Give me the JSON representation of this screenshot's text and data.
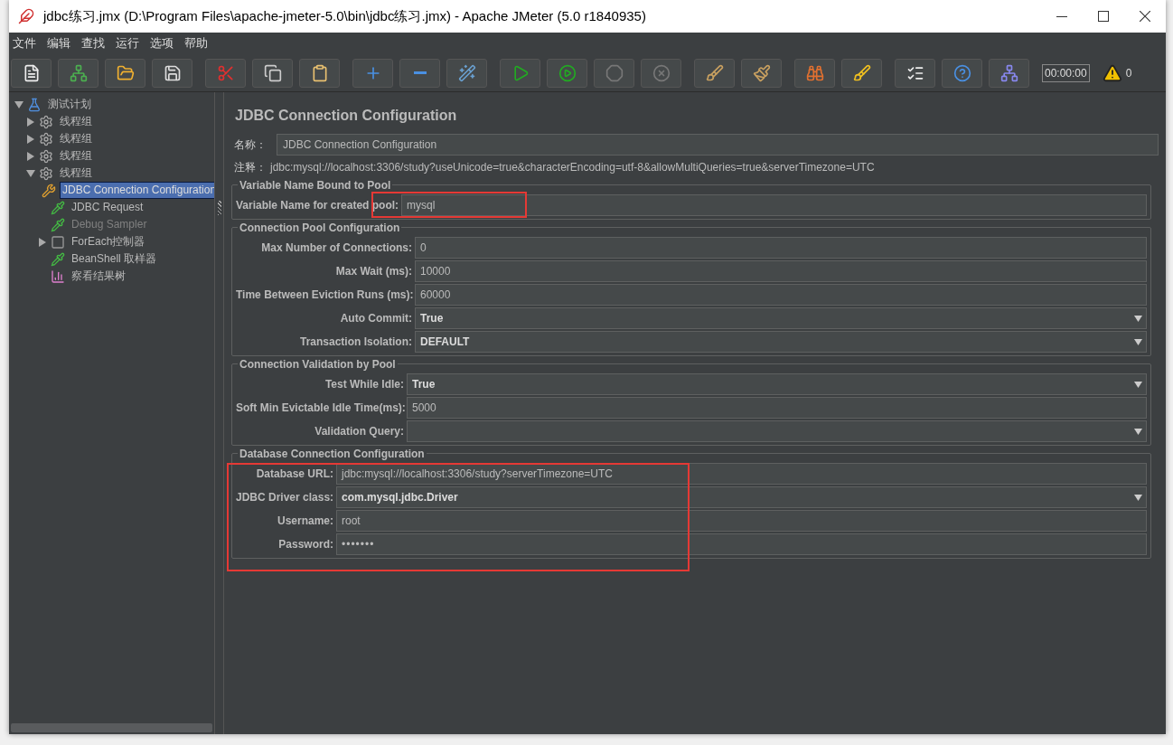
{
  "window": {
    "title": "jdbc练习.jmx (D:\\Program Files\\apache-jmeter-5.0\\bin\\jdbc练习.jmx) - Apache JMeter (5.0 r1840935)"
  },
  "menu": [
    "文件",
    "编辑",
    "查找",
    "运行",
    "选项",
    "帮助"
  ],
  "toolbar": {
    "timer": "00:00:00",
    "warnings": "0"
  },
  "tree": [
    {
      "label": "测试计划",
      "kind": "testplan",
      "expanded": true,
      "selected": false,
      "disabled": false,
      "children": [
        {
          "label": "线程组",
          "kind": "threadgroup",
          "expanded": false,
          "selected": false,
          "disabled": false
        },
        {
          "label": "线程组",
          "kind": "threadgroup",
          "expanded": false,
          "selected": false,
          "disabled": false
        },
        {
          "label": "线程组",
          "kind": "threadgroup",
          "expanded": false,
          "selected": false,
          "disabled": false
        },
        {
          "label": "线程组",
          "kind": "threadgroup",
          "expanded": true,
          "selected": false,
          "disabled": false,
          "children": [
            {
              "label": "JDBC Connection Configuration",
              "kind": "config",
              "selected": true,
              "disabled": false
            },
            {
              "label": "JDBC Request",
              "kind": "sampler",
              "selected": false,
              "disabled": false
            },
            {
              "label": "Debug Sampler",
              "kind": "sampler",
              "selected": false,
              "disabled": true
            },
            {
              "label": "ForEach控制器",
              "kind": "controller",
              "expanded": false,
              "selected": false,
              "disabled": false
            },
            {
              "label": "BeanShell 取样器",
              "kind": "sampler",
              "selected": false,
              "disabled": false
            },
            {
              "label": "察看结果树",
              "kind": "listener",
              "selected": false,
              "disabled": false
            }
          ]
        }
      ]
    }
  ],
  "panel": {
    "title": "JDBC Connection Configuration",
    "name_label": "名称：",
    "name_value": "JDBC Connection Configuration",
    "comment_label": "注释：",
    "comment_value": "jdbc:mysql://localhost:3306/study?useUnicode=true&characterEncoding=utf-8&allowMultiQueries=true&serverTimezone=UTC"
  },
  "sections": [
    {
      "title": "Variable Name Bound to Pool",
      "highlighted": false,
      "rows": [
        {
          "label": "Variable Name for created pool:",
          "kind": "text",
          "value": "mysql",
          "highlighted": true
        }
      ]
    },
    {
      "title": "Connection Pool Configuration",
      "highlighted": false,
      "rows": [
        {
          "label": "Max Number of Connections:",
          "kind": "text",
          "value": "0",
          "highlighted": false
        },
        {
          "label": "Max Wait (ms):",
          "kind": "text",
          "value": "10000",
          "highlighted": false
        },
        {
          "label": "Time Between Eviction Runs (ms):",
          "kind": "text",
          "value": "60000",
          "highlighted": false
        },
        {
          "label": "Auto Commit:",
          "kind": "select",
          "value": "True",
          "highlighted": false
        },
        {
          "label": "Transaction Isolation:",
          "kind": "select",
          "value": "DEFAULT",
          "highlighted": false
        }
      ]
    },
    {
      "title": "Connection Validation by Pool",
      "highlighted": false,
      "rows": [
        {
          "label": "Test While Idle:",
          "kind": "select",
          "value": "True",
          "highlighted": false
        },
        {
          "label": "Soft Min Evictable Idle Time(ms):",
          "kind": "text",
          "value": "5000",
          "highlighted": false
        },
        {
          "label": "Validation Query:",
          "kind": "select",
          "highlighted": false
        }
      ]
    },
    {
      "title": "Database Connection Configuration",
      "highlighted": true,
      "rows": [
        {
          "label": "Database URL:",
          "kind": "text",
          "value": "jdbc:mysql://localhost:3306/study?serverTimezone=UTC",
          "highlighted": false
        },
        {
          "label": "JDBC Driver class:",
          "kind": "select",
          "value": "com.mysql.jdbc.Driver",
          "highlighted": false
        },
        {
          "label": "Username:",
          "kind": "text",
          "value": "root",
          "highlighted": false
        },
        {
          "label": "Password:",
          "kind": "password",
          "value": "•••••••",
          "highlighted": false
        }
      ]
    }
  ]
}
